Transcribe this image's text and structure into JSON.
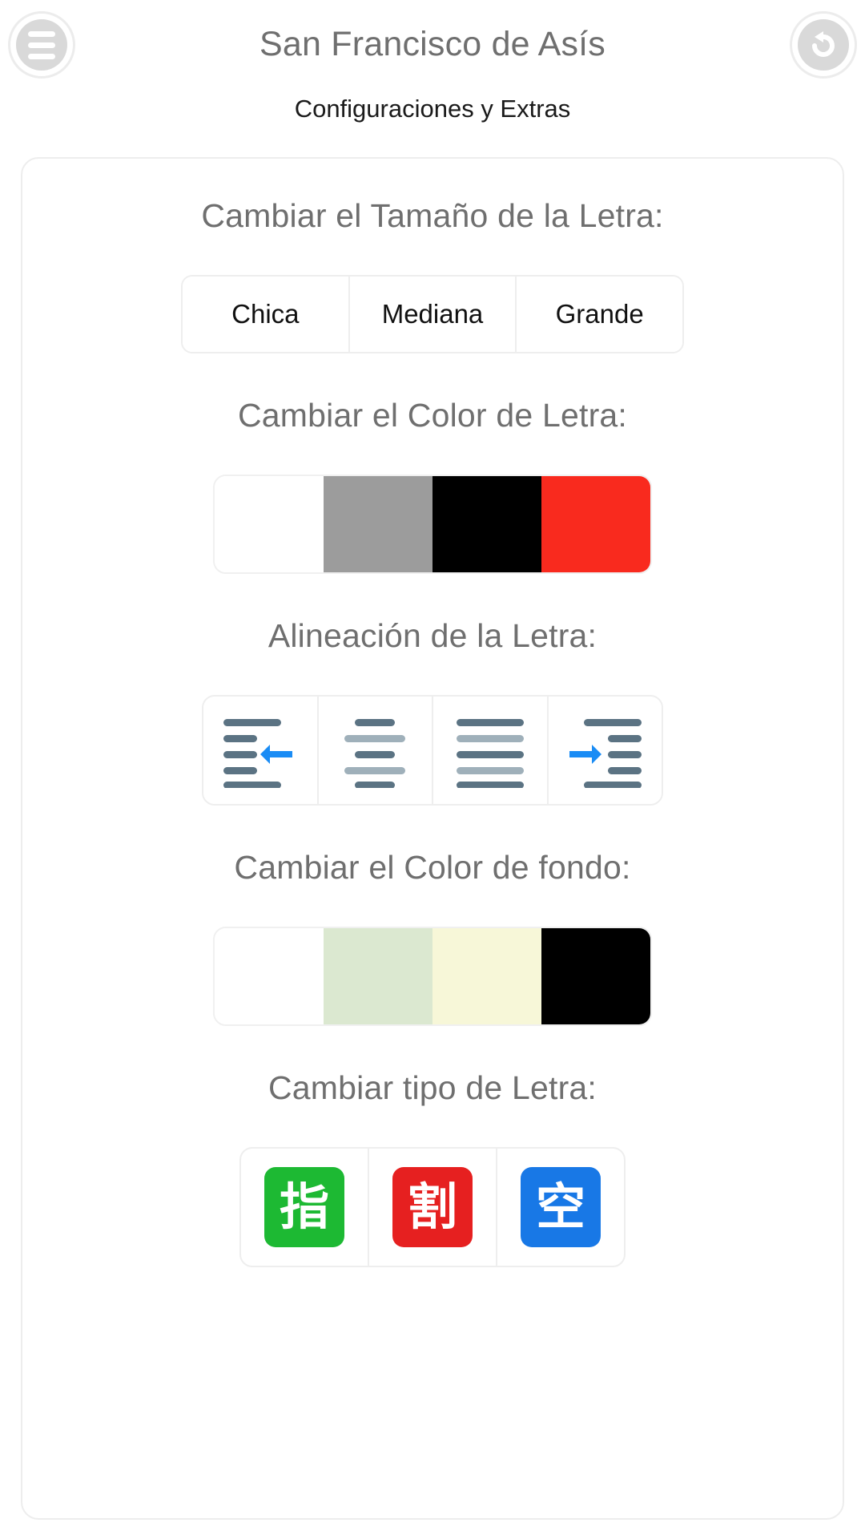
{
  "header": {
    "title": "San Francisco de Asís",
    "subtitle": "Configuraciones y Extras",
    "menu_icon": "hamburger-menu-icon",
    "undo_icon": "undo-back-arrow-icon"
  },
  "sections": {
    "font_size": {
      "label": "Cambiar el Tamaño de la Letra:",
      "options": [
        {
          "label": "Chica"
        },
        {
          "label": "Mediana"
        },
        {
          "label": "Grande"
        }
      ]
    },
    "font_color": {
      "label": "Cambiar el Color de Letra:",
      "swatches": [
        {
          "name": "white",
          "color": "#ffffff"
        },
        {
          "name": "gray",
          "color": "#9c9c9c"
        },
        {
          "name": "black",
          "color": "#000000"
        },
        {
          "name": "red",
          "color": "#f92a1e"
        }
      ]
    },
    "alignment": {
      "label": "Alineación de la Letra:",
      "options": [
        {
          "name": "align-left-indent-decrease-icon"
        },
        {
          "name": "align-center-icon"
        },
        {
          "name": "align-justify-icon"
        },
        {
          "name": "align-indent-increase-icon"
        }
      ],
      "line_dark": "#5b7383",
      "line_light": "#9fb0ba",
      "arrow_color": "#1a8cf5"
    },
    "background_color": {
      "label": "Cambiar el Color de fondo:",
      "swatches": [
        {
          "name": "white",
          "color": "#ffffff"
        },
        {
          "name": "light-green",
          "color": "#dbe8d0"
        },
        {
          "name": "light-yellow",
          "color": "#f7f7d8"
        },
        {
          "name": "black",
          "color": "#000000"
        }
      ]
    },
    "font_type": {
      "label": "Cambiar tipo de Letra:",
      "options": [
        {
          "glyph": "指",
          "bg": "#1db933",
          "name": "emoji-green-finger"
        },
        {
          "glyph": "割",
          "bg": "#e62020",
          "name": "emoji-red-discount"
        },
        {
          "glyph": "空",
          "bg": "#1878e6",
          "name": "emoji-blue-vacancy"
        }
      ]
    }
  }
}
